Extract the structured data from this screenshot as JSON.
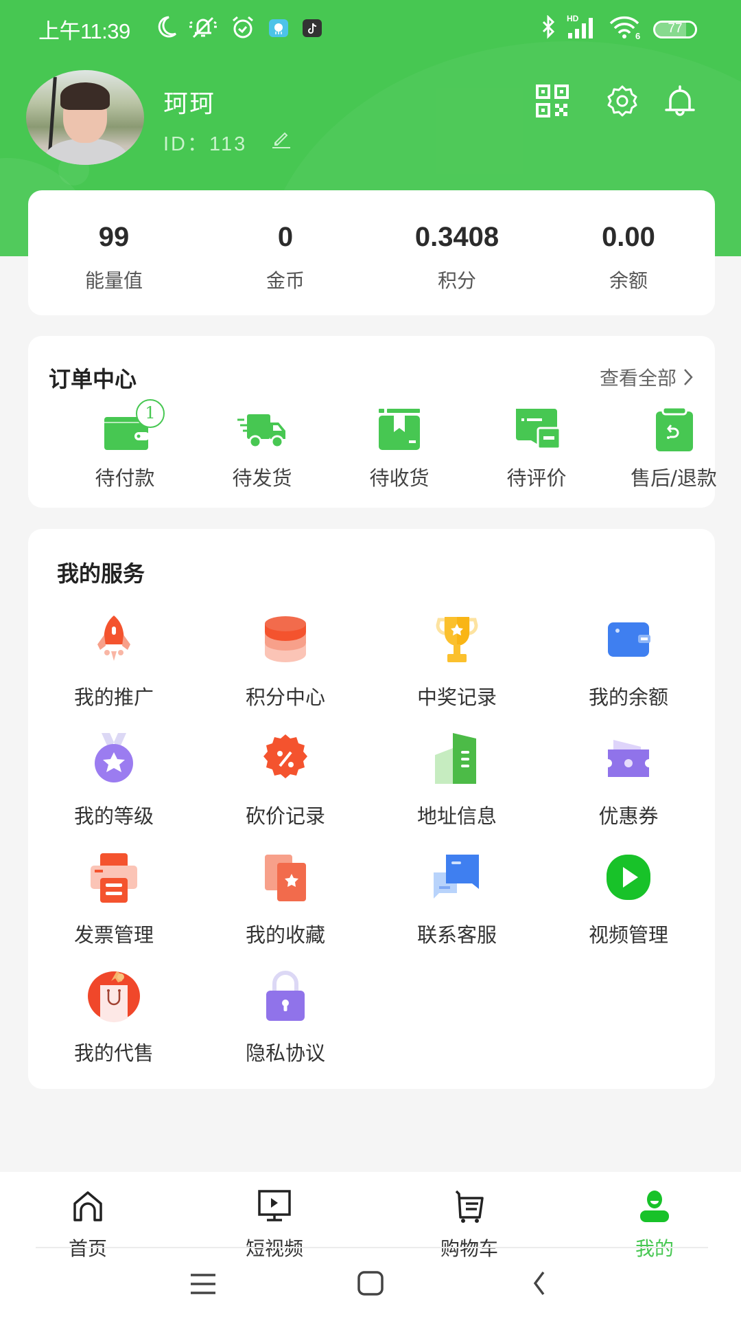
{
  "status_bar": {
    "time": "上午11:39",
    "left_icons": [
      "moon-icon",
      "bell-muted-icon",
      "alarm-icon",
      "weather-app-icon",
      "tiktok-app-icon"
    ],
    "right_icons": [
      "bluetooth-icon",
      "hd-signal-icon",
      "wifi6-icon",
      "battery-icon"
    ],
    "network_label": "HD",
    "wifi_label": "6",
    "battery": "77"
  },
  "profile": {
    "name": "珂珂",
    "id_label": "ID：113",
    "actions": [
      "qr-code-icon",
      "settings-icon",
      "notification-bell-icon"
    ]
  },
  "stats": [
    {
      "value": "99",
      "label": "能量值"
    },
    {
      "value": "0",
      "label": "金币"
    },
    {
      "value": "0.3408",
      "label": "积分"
    },
    {
      "value": "0.00",
      "label": "余额"
    }
  ],
  "orders": {
    "title": "订单中心",
    "view_all": "查看全部",
    "items": [
      {
        "label": "待付款",
        "icon": "wallet-icon",
        "badge": "1"
      },
      {
        "label": "待发货",
        "icon": "truck-icon"
      },
      {
        "label": "待收货",
        "icon": "package-icon"
      },
      {
        "label": "待评价",
        "icon": "comment-icon"
      },
      {
        "label": "售后/退款",
        "icon": "refund-icon"
      }
    ]
  },
  "services": {
    "title": "我的服务",
    "items": [
      {
        "label": "我的推广",
        "icon": "rocket-icon"
      },
      {
        "label": "积分中心",
        "icon": "coins-icon"
      },
      {
        "label": "中奖记录",
        "icon": "trophy-icon"
      },
      {
        "label": "我的余额",
        "icon": "wallet-icon"
      },
      {
        "label": "我的等级",
        "icon": "medal-icon"
      },
      {
        "label": "砍价记录",
        "icon": "discount-icon"
      },
      {
        "label": "地址信息",
        "icon": "building-icon"
      },
      {
        "label": "优惠券",
        "icon": "coupon-icon"
      },
      {
        "label": "发票管理",
        "icon": "invoice-icon"
      },
      {
        "label": "我的收藏",
        "icon": "favorites-icon"
      },
      {
        "label": "联系客服",
        "icon": "chat-icon"
      },
      {
        "label": "视频管理",
        "icon": "video-play-icon"
      },
      {
        "label": "我的代售",
        "icon": "shopping-bag-icon"
      },
      {
        "label": "隐私协议",
        "icon": "lock-icon"
      }
    ]
  },
  "tabbar": {
    "items": [
      {
        "label": "首页",
        "icon": "home-icon"
      },
      {
        "label": "短视频",
        "icon": "short-video-icon"
      },
      {
        "label": "购物车",
        "icon": "cart-icon"
      },
      {
        "label": "我的",
        "icon": "profile-icon",
        "active": true
      }
    ]
  },
  "theme": {
    "primary": "#47c752",
    "background": "#f5f5f5"
  }
}
